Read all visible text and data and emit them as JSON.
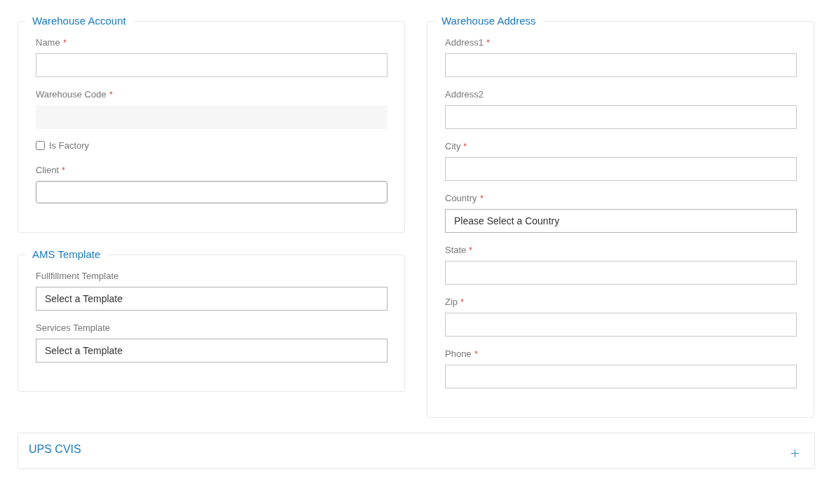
{
  "left_column": [
    {
      "title": "Warehouse Account",
      "fields": [
        {
          "kind": "text",
          "label": "Name",
          "required": true
        },
        {
          "kind": "readonly",
          "label": "Warehouse Code",
          "required": true
        },
        {
          "kind": "checkbox",
          "label": "Is Factory",
          "checked": false
        },
        {
          "kind": "lookup",
          "label": "Client",
          "required": true
        }
      ]
    },
    {
      "title": "AMS Template",
      "fields": [
        {
          "kind": "select",
          "label": "Fullfillment Template",
          "required": false,
          "value": "Select a Template"
        },
        {
          "kind": "select",
          "label": "Services Template",
          "required": false,
          "value": "Select a Template"
        }
      ]
    }
  ],
  "right_column": [
    {
      "title": "Warehouse Address",
      "fields": [
        {
          "kind": "text",
          "label": "Address1",
          "required": true
        },
        {
          "kind": "text",
          "label": "Address2",
          "required": false
        },
        {
          "kind": "text",
          "label": "City",
          "required": true
        },
        {
          "kind": "select",
          "label": "Country",
          "required": true,
          "value": "Please Select a Country"
        },
        {
          "kind": "text",
          "label": "State",
          "required": true
        },
        {
          "kind": "text",
          "label": "Zip",
          "required": true
        },
        {
          "kind": "text",
          "label": "Phone",
          "required": true
        }
      ]
    }
  ],
  "collapsible_panel": {
    "title": "UPS CVIS",
    "expanded": false
  }
}
